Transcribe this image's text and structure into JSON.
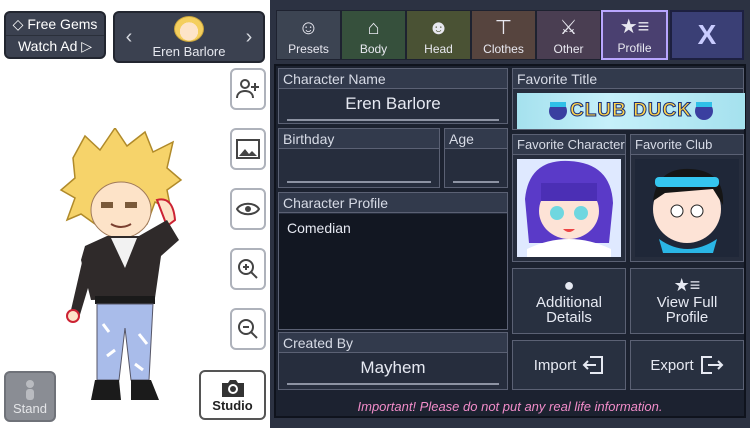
{
  "currency": {
    "free_gems_label": "Free Gems",
    "watch_ad_label": "Watch Ad ▷"
  },
  "character_selector": {
    "name": "Eren Barlore",
    "prev_arrow": "‹",
    "next_arrow": "›"
  },
  "tools": {
    "add_icon": "add-person-icon",
    "background_icon": "image-icon",
    "visibility_icon": "eye-icon",
    "zoom_in_icon": "zoom-in-icon",
    "zoom_out_icon": "zoom-out-icon"
  },
  "bottom": {
    "stand_label": "Stand",
    "studio_label": "Studio"
  },
  "tabs": [
    {
      "label": "Presets",
      "icon": "person-icon"
    },
    {
      "label": "Body",
      "icon": "shirt-icon"
    },
    {
      "label": "Head",
      "icon": "head-icon"
    },
    {
      "label": "Clothes",
      "icon": "tshirt-icon"
    },
    {
      "label": "Other",
      "icon": "sword-cat-icon"
    },
    {
      "label": "Profile",
      "icon": "star-list-icon",
      "active": true
    }
  ],
  "close_label": "X",
  "profile": {
    "character_name_label": "Character Name",
    "character_name": "Eren Barlore",
    "birthday_label": "Birthday",
    "birthday": "",
    "age_label": "Age",
    "age": "",
    "character_profile_label": "Character Profile",
    "character_profile": "Comedian",
    "created_by_label": "Created By",
    "created_by": "Mayhem",
    "favorite_title_label": "Favorite Title",
    "favorite_title": "CLUB DUCK",
    "favorite_character_label": "Favorite Character",
    "favorite_club_label": "Favorite Club",
    "additional_details_label": "Additional Details",
    "view_full_profile_label": "View Full Profile",
    "import_label": "Import",
    "export_label": "Export",
    "notice": "Important! Please do not put any real life information."
  }
}
